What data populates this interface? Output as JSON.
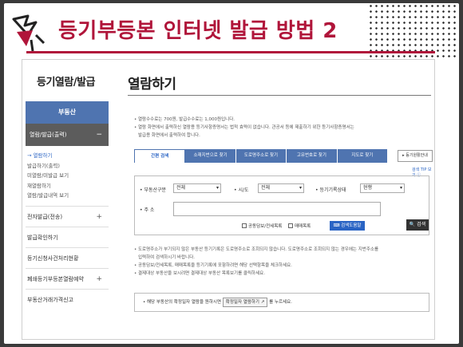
{
  "slide": {
    "title": "등기부등본 인터넷 발급 방법 2"
  },
  "site": {
    "side_title": "등기열람/발급",
    "page_title": "열람하기"
  },
  "sidebar": {
    "category": "부동산",
    "active_menu": "열람/발급(출력)",
    "active_toggle": "−",
    "sub_items": [
      "→ 열람하기",
      "발급하기(출력)",
      "미열람/미발급 보기",
      "재열람하기",
      "열람/발급내역 보기"
    ],
    "menus": [
      {
        "label": "전자발급(전송)",
        "toggle": "+"
      },
      {
        "label": "발급확인하기",
        "toggle": ""
      },
      {
        "label": "등기신청사건처리현황",
        "toggle": ""
      },
      {
        "label": "폐쇄등기부등본열람예약",
        "toggle": "+"
      },
      {
        "label": "부동산거래가격신고",
        "toggle": ""
      }
    ]
  },
  "notes_top": [
    "• 열람수수료는 700원, 발급수수료는 1,000원입니다.",
    "• 열람 화면에서 출력하신 열람용 등기사항증명서는 법적 효력이 없습니다. 관공서 등에 제출하기 위한 등기사항증명서는",
    "발급용 화면에서 출력하여 합니다."
  ],
  "tabs": [
    "간편 검색",
    "소재지번으로 찾기",
    "도로명주소로 찾기",
    "고유번호로 찾기",
    "지도로 찾기"
  ],
  "help_button": "▸ 등기원활안내",
  "search_tip": "검색 TIP 보기 ⓘ",
  "form": {
    "type_label": "• 부동산구분",
    "type_value": "전체",
    "city_label": "• 시/도",
    "city_value": "전체",
    "status_label": "• 등기기록상태",
    "status_value": "현행",
    "addr_label": "• 주 소",
    "chk1": "공동담보/전세목록",
    "chk2": "매매목록",
    "keyboard_button": "⌨ 검색도움말",
    "search_button": "🔍 검색"
  },
  "notes_bottom": [
    "• 도로명주소가 부기되지 않은 부동산 등기기록은 도로명주소로 조회되지 않습니다. 도로명주소로 조회되지 않는 경우에는 지번주소를",
    "입력하여 검색하시기 바랍니다.",
    "• 공동담보/전세목록, 매매목록을 등기기록에 포함하려면 해당 선택항목을 체크하세요.",
    "• 결제대상 부동산을 보시려면 결제대상 부동산 목록보기를 클릭하세요."
  ],
  "notice": {
    "prefix": "• 해당 부동산의 확정일자 열람을 원하시면",
    "button": "확정일자 열람하기 ↗",
    "suffix": "를 누르세요."
  }
}
